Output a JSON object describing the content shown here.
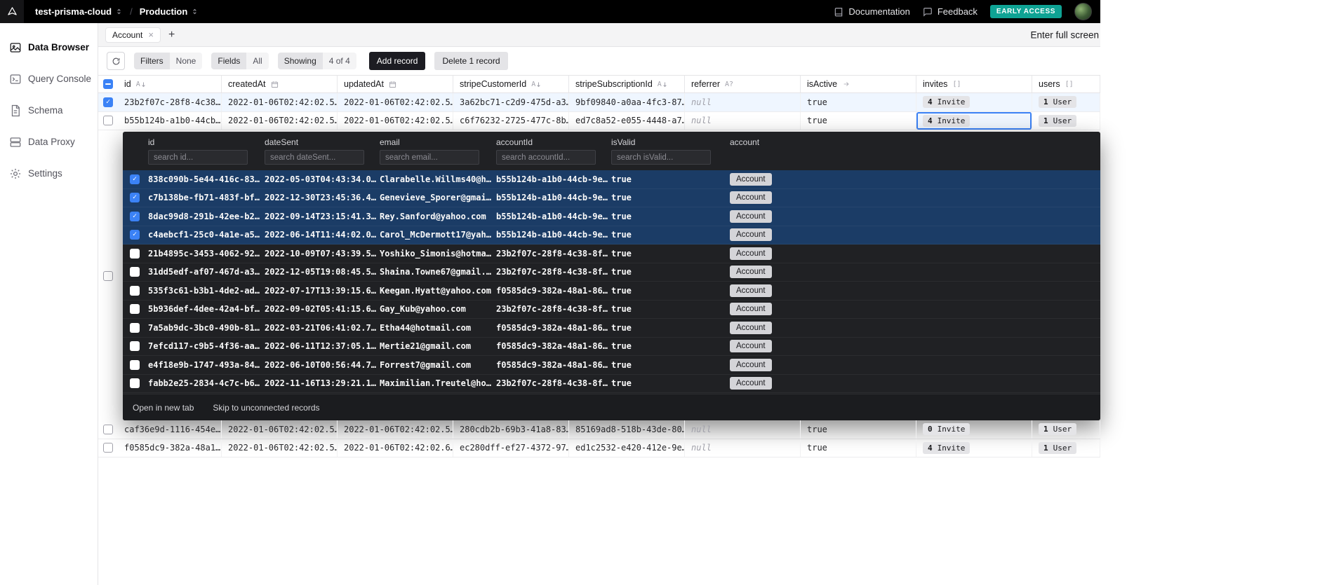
{
  "topbar": {
    "project": "test-prisma-cloud",
    "separator": "/",
    "environment": "Production",
    "documentation_label": "Documentation",
    "feedback_label": "Feedback",
    "early_access_badge": "EARLY ACCESS"
  },
  "sidebar": {
    "items": [
      {
        "label": "Data Browser",
        "active": true
      },
      {
        "label": "Query Console",
        "active": false
      },
      {
        "label": "Schema",
        "active": false
      },
      {
        "label": "Data Proxy",
        "active": false
      },
      {
        "label": "Settings",
        "active": false
      }
    ]
  },
  "tabs": {
    "items": [
      {
        "label": "Account"
      }
    ],
    "fullscreen_label": "Enter full screen"
  },
  "toolbar": {
    "filters_label": "Filters",
    "filters_value": "None",
    "fields_label": "Fields",
    "fields_value": "All",
    "showing_label": "Showing",
    "showing_value": "4 of 4",
    "add_record_label": "Add record",
    "delete_record_label": "Delete 1 record"
  },
  "table": {
    "columns": [
      {
        "label": "id",
        "icon": "sort-alpha"
      },
      {
        "label": "createdAt",
        "icon": "calendar"
      },
      {
        "label": "updatedAt",
        "icon": "calendar"
      },
      {
        "label": "stripeCustomerId",
        "icon": "sort-alpha"
      },
      {
        "label": "stripeSubscriptionId",
        "icon": "sort-alpha"
      },
      {
        "label": "referrer",
        "icon": "nullable-text"
      },
      {
        "label": "isActive",
        "icon": "arrow"
      },
      {
        "label": "invites",
        "icon": "relation-list"
      },
      {
        "label": "users",
        "icon": "relation-list"
      }
    ],
    "nullable_icon_text": "A?",
    "sort_icon_text": "A",
    "relation_icon_text": "[]",
    "rows": [
      {
        "id": "23b2f07c-28f8-4c38…",
        "createdAt": "2022-01-06T02:42:02.5…",
        "updatedAt": "2022-01-06T02:42:02.5…",
        "stripeCustomerId": "3a62bc71-c2d9-475d-a3…",
        "stripeSubscriptionId": "9bf09840-a0aa-4fc3-87…",
        "referrer": "null",
        "isActive": "true",
        "invites_count": "4",
        "invites_label": "Invite",
        "users_count": "1",
        "users_label": "User"
      },
      {
        "id": "b55b124b-a1b0-44cb…",
        "createdAt": "2022-01-06T02:42:02.5…",
        "updatedAt": "2022-01-06T02:42:02.5…",
        "stripeCustomerId": "c6f76232-2725-477c-8b…",
        "stripeSubscriptionId": "ed7c8a52-e055-4448-a7…",
        "referrer": "null",
        "isActive": "true",
        "invites_count": "4",
        "invites_label": "Invite",
        "users_count": "1",
        "users_label": "User"
      },
      {
        "id": "caf36e9d-1116-454e…",
        "createdAt": "2022-01-06T02:42:02.5…",
        "updatedAt": "2022-01-06T02:42:02.5…",
        "stripeCustomerId": "280cdb2b-69b3-41a8-83…",
        "stripeSubscriptionId": "85169ad8-518b-43de-80…",
        "referrer": "null",
        "isActive": "true",
        "invites_count": "0",
        "invites_label": "Invite",
        "users_count": "1",
        "users_label": "User"
      },
      {
        "id": "f0585dc9-382a-48a1…",
        "createdAt": "2022-01-06T02:42:02.5…",
        "updatedAt": "2022-01-06T02:42:02.6…",
        "stripeCustomerId": "ec280dff-ef27-4372-97…",
        "stripeSubscriptionId": "ed1c2532-e420-412e-9e…",
        "referrer": "null",
        "isActive": "true",
        "invites_count": "4",
        "invites_label": "Invite",
        "users_count": "1",
        "users_label": "User"
      }
    ]
  },
  "relation_popup": {
    "columns": [
      "id",
      "dateSent",
      "email",
      "accountId",
      "isValid",
      "account"
    ],
    "search_placeholders": [
      "search id...",
      "search dateSent...",
      "search email...",
      "search accountId...",
      "search isValid..."
    ],
    "rows": [
      {
        "id": "838c090b-5e44-416c-83…",
        "dateSent": "2022-05-03T04:43:34.0…",
        "email": "Clarabelle.Willms40@h…",
        "accountId": "b55b124b-a1b0-44cb-9e…",
        "isValid": "true",
        "account": "Account"
      },
      {
        "id": "c7b138be-fb71-483f-bf…",
        "dateSent": "2022-12-30T23:45:36.4…",
        "email": "Genevieve_Sporer@gmai…",
        "accountId": "b55b124b-a1b0-44cb-9e…",
        "isValid": "true",
        "account": "Account"
      },
      {
        "id": "8dac99d8-291b-42ee-b2…",
        "dateSent": "2022-09-14T23:15:41.3…",
        "email": "Rey.Sanford@yahoo.com",
        "accountId": "b55b124b-a1b0-44cb-9e…",
        "isValid": "true",
        "account": "Account"
      },
      {
        "id": "c4aebcf1-25c0-4a1e-a5…",
        "dateSent": "2022-06-14T11:44:02.0…",
        "email": "Carol_McDermott17@yah…",
        "accountId": "b55b124b-a1b0-44cb-9e…",
        "isValid": "true",
        "account": "Account"
      },
      {
        "id": "21b4895c-3453-4062-92…",
        "dateSent": "2022-10-09T07:43:39.5…",
        "email": "Yoshiko_Simonis@hotma…",
        "accountId": "23b2f07c-28f8-4c38-8f…",
        "isValid": "true",
        "account": "Account"
      },
      {
        "id": "31dd5edf-af07-467d-a3…",
        "dateSent": "2022-12-05T19:08:45.5…",
        "email": "Shaina.Towne67@gmail.…",
        "accountId": "23b2f07c-28f8-4c38-8f…",
        "isValid": "true",
        "account": "Account"
      },
      {
        "id": "535f3c61-b3b1-4de2-ad…",
        "dateSent": "2022-07-17T13:39:15.6…",
        "email": "Keegan.Hyatt@yahoo.com",
        "accountId": "f0585dc9-382a-48a1-86…",
        "isValid": "true",
        "account": "Account"
      },
      {
        "id": "5b936def-4dee-42a4-bf…",
        "dateSent": "2022-09-02T05:41:15.6…",
        "email": "Gay_Kub@yahoo.com",
        "accountId": "23b2f07c-28f8-4c38-8f…",
        "isValid": "true",
        "account": "Account"
      },
      {
        "id": "7a5ab9dc-3bc0-490b-81…",
        "dateSent": "2022-03-21T06:41:02.7…",
        "email": "Etha44@hotmail.com",
        "accountId": "f0585dc9-382a-48a1-86…",
        "isValid": "true",
        "account": "Account"
      },
      {
        "id": "7efcd117-c9b5-4f36-aa…",
        "dateSent": "2022-06-11T12:37:05.1…",
        "email": "Mertie21@gmail.com",
        "accountId": "f0585dc9-382a-48a1-86…",
        "isValid": "true",
        "account": "Account"
      },
      {
        "id": "e4f18e9b-1747-493a-84…",
        "dateSent": "2022-06-10T00:56:44.7…",
        "email": "Forrest7@gmail.com",
        "accountId": "f0585dc9-382a-48a1-86…",
        "isValid": "true",
        "account": "Account"
      },
      {
        "id": "fabb2e25-2834-4c7c-b6…",
        "dateSent": "2022-11-16T13:29:21.1…",
        "email": "Maximilian.Treutel@ho…",
        "accountId": "23b2f07c-28f8-4c38-8f…",
        "isValid": "true",
        "account": "Account"
      }
    ],
    "footer": {
      "open_label": "Open in new tab",
      "skip_label": "Skip to unconnected records"
    }
  },
  "colors": {
    "topbar_bg": "#000000",
    "early_access_teal": "#0fa394",
    "selection_blue": "#3b82f6",
    "row_selected_bg": "#eff6ff",
    "popup_bg": "#202124",
    "popup_selected_row": "#1b3c66"
  }
}
